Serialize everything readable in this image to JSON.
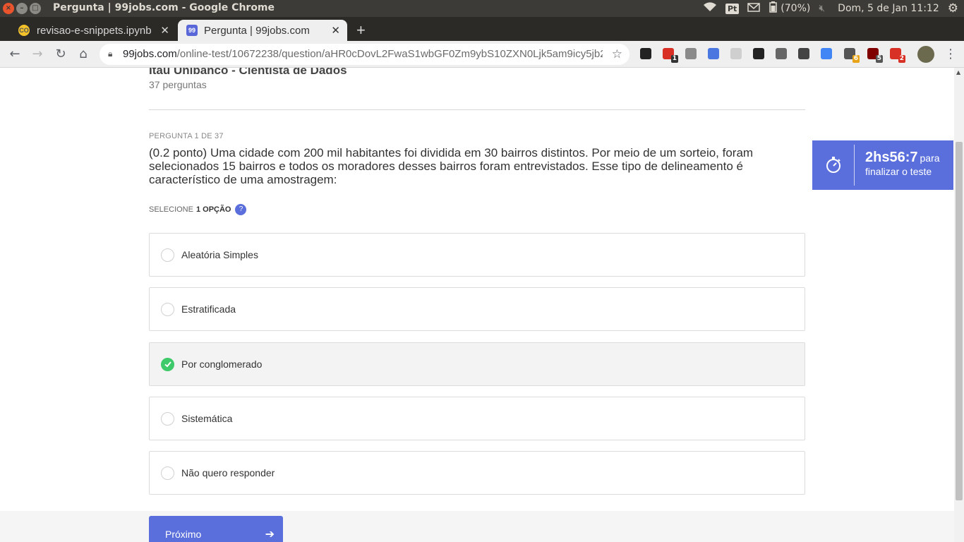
{
  "os": {
    "window_title": "Pergunta | 99jobs.com - Google Chrome",
    "battery": "(70%)",
    "clock": "Dom,  5 de Jan 11:12",
    "keyboard": "Pt"
  },
  "tabs": [
    {
      "title": "revisao-e-snippets.ipynb",
      "favicon": "CO",
      "active": false
    },
    {
      "title": "Pergunta | 99jobs.com",
      "favicon": "99",
      "active": true
    }
  ],
  "address_bar": {
    "host": "99jobs.com",
    "path": "/online-test/10672238/question/aHR0cDovL2FwaS1wbGF0Zm9ybS10ZXN0Ljk5am9icy5jb20v..."
  },
  "extensions": [
    {
      "name": "square-ext-icon",
      "color": "#222222",
      "badge": ""
    },
    {
      "name": "calendar-ext-icon",
      "color": "#d93025",
      "badge": "1"
    },
    {
      "name": "camera-ext-icon",
      "color": "#8a8a8a",
      "badge": ""
    },
    {
      "name": "translate-ext-icon",
      "color": "#4a78e0",
      "badge": ""
    },
    {
      "name": "tex-ext-icon",
      "color": "#cfcfcf",
      "badge": ""
    },
    {
      "name": "gnome-ext-icon",
      "color": "#222222",
      "badge": ""
    },
    {
      "name": "cloud-ext-icon",
      "color": "#666666",
      "badge": ""
    },
    {
      "name": "markdown-ext-icon",
      "color": "#444444",
      "badge": ""
    },
    {
      "name": "google-ext-icon",
      "color": "#4285f4",
      "badge": ""
    },
    {
      "name": "plane-ext-icon",
      "color": "#555555",
      "badge": "6"
    },
    {
      "name": "ublock-ext-icon",
      "color": "#800000",
      "badge": "5"
    },
    {
      "name": "adblock-ext-icon",
      "color": "#d93025",
      "badge": "2"
    }
  ],
  "test": {
    "title": "Itaú Unibanco - Cientista de Dados",
    "count": "37 perguntas"
  },
  "question": {
    "counter": "PERGUNTA 1 DE 37",
    "text": "(0.2 ponto) Uma cidade com 200 mil habitantes foi dividida em 30 bairros distintos. Por meio de um sorteio, foram selecionados 15 bairros e todos os moradores desses bairros foram entrevistados. Esse tipo de delineamento é característico de uma amostragem:",
    "select_prefix": "SELECIONE",
    "select_count": "1 OPÇÃO",
    "help": "?"
  },
  "options": [
    {
      "label": "Aleatória Simples",
      "selected": false
    },
    {
      "label": "Estratificada",
      "selected": false
    },
    {
      "label": "Por conglomerado",
      "selected": true
    },
    {
      "label": "Sistemática",
      "selected": false
    },
    {
      "label": "Não quero responder",
      "selected": false
    }
  ],
  "next_button": {
    "label": "Próximo"
  },
  "timer": {
    "time": "2hs56:7",
    "suffix": "para",
    "subtitle": "finalizar o teste"
  },
  "colors": {
    "accent": "#5a6fdb",
    "check": "#3ec96a"
  }
}
